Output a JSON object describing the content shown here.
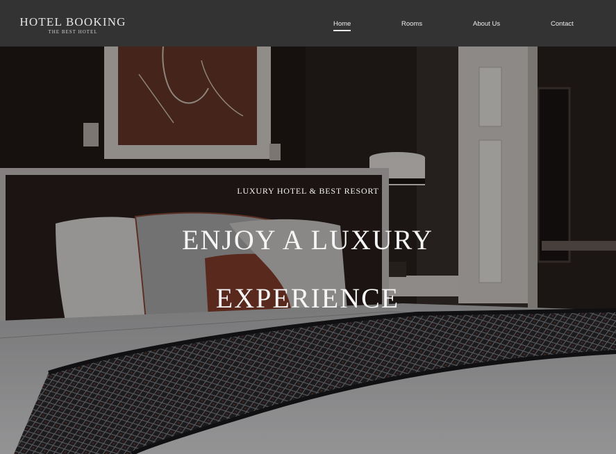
{
  "brand": {
    "title": "HOTEL BOOKING",
    "tagline": "THE BEST HOTEL"
  },
  "nav": {
    "items": [
      {
        "label": "Home",
        "active": true
      },
      {
        "label": "Rooms",
        "active": false
      },
      {
        "label": "About Us",
        "active": false
      },
      {
        "label": "Contact",
        "active": false
      }
    ]
  },
  "hero": {
    "kicker": "LUXURY HOTEL & BEST RESORT",
    "heading": "ENJOY A LUXURY EXPERIENCE",
    "background": "hotel-bedroom-photo"
  },
  "colors": {
    "header_bg": "#333333",
    "header_text": "#ededed",
    "hero_text": "#f5f5f5"
  }
}
